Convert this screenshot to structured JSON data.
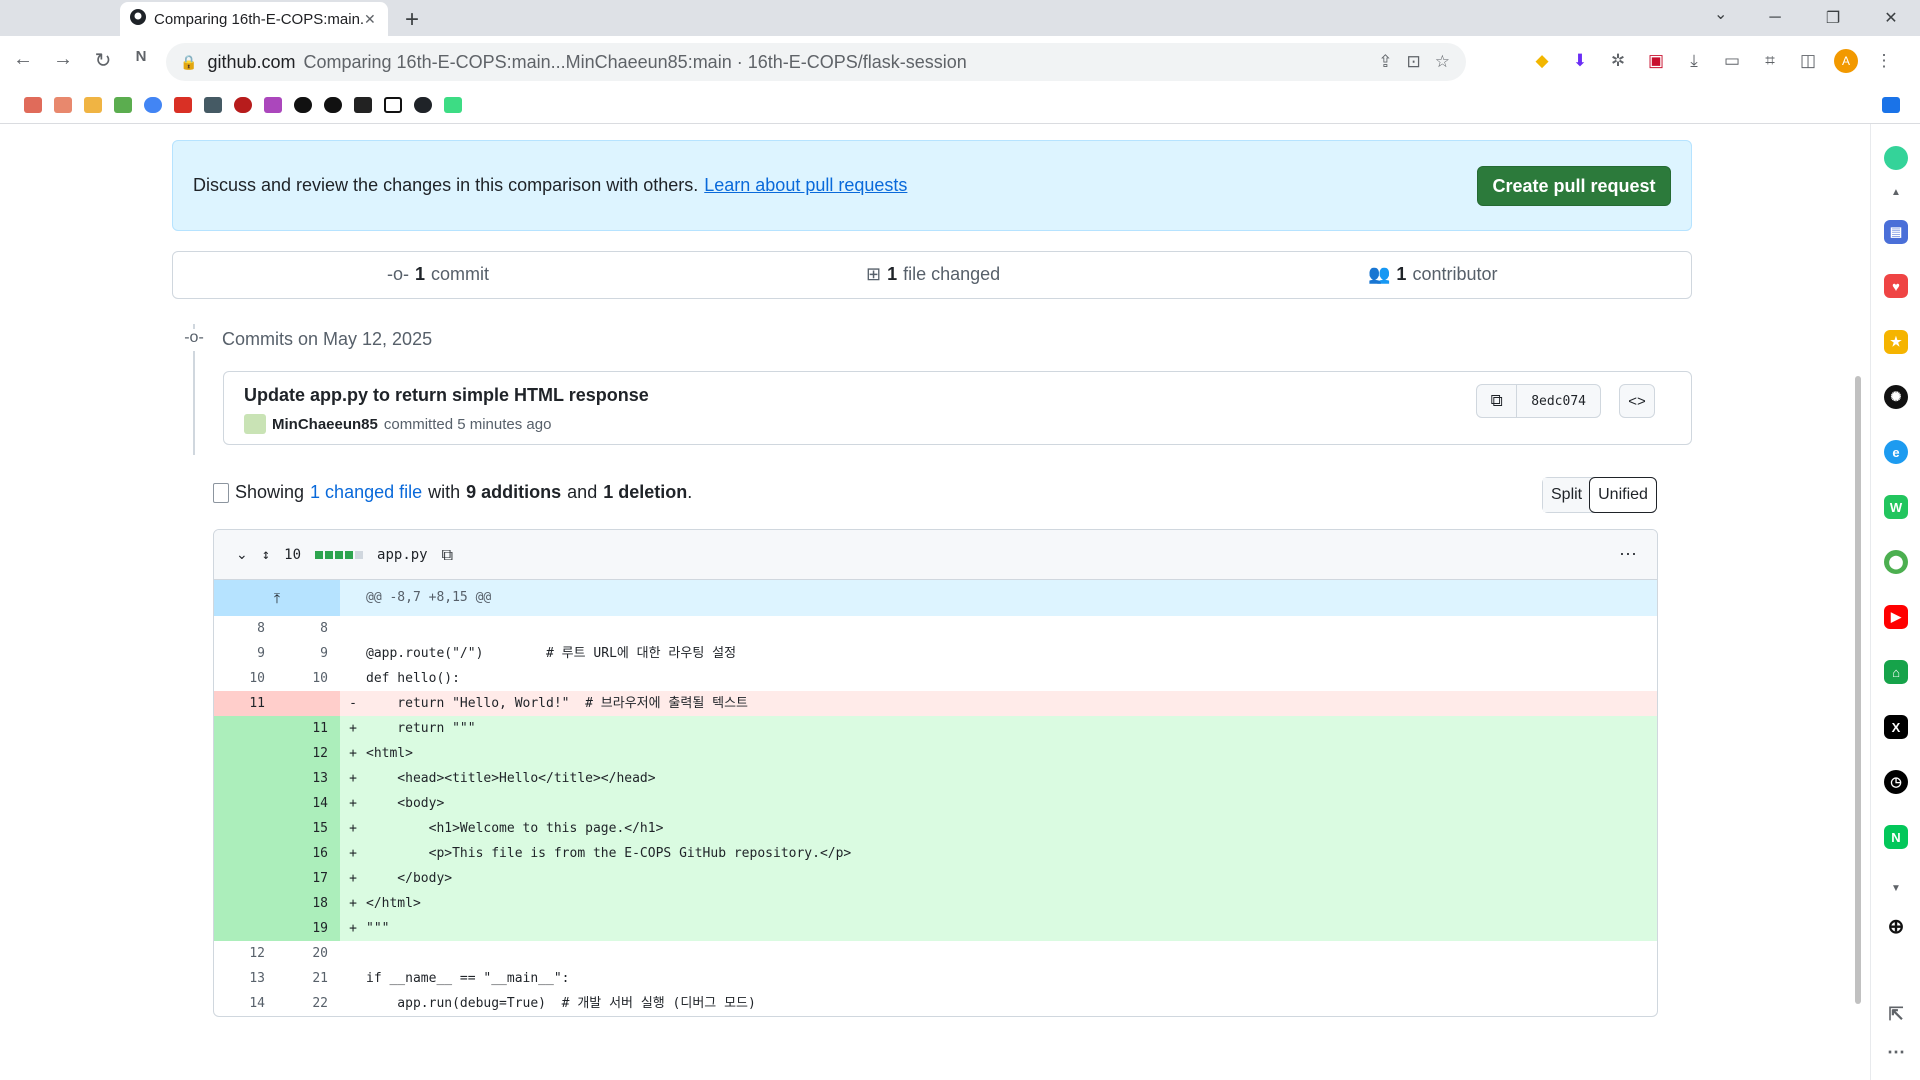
{
  "browser": {
    "tab_title": "Comparing 16th-E-COPS:main...",
    "url_domain": "github.com",
    "url_rest": "Comparing 16th-E-COPS:main...MinChaeeun85:main · 16th-E-COPS/flask-session"
  },
  "banner": {
    "text": "Discuss and review the changes in this comparison with others.",
    "link": "Learn about pull requests",
    "button": "Create pull request"
  },
  "summary": {
    "commits_count": "1",
    "commits_label": "commit",
    "files_count": "1",
    "files_label": "file changed",
    "contributors_count": "1",
    "contributors_label": "contributor"
  },
  "commits": {
    "heading": "Commits on May 12, 2025",
    "message": "Update app.py to return simple HTML response",
    "author": "MinChaeeun85",
    "meta": "committed 5 minutes ago",
    "sha": "8edc074"
  },
  "showing": {
    "prefix": "Showing",
    "files_link": "1 changed file",
    "with": "with",
    "additions": "9 additions",
    "and": "and",
    "deletions": "1 deletion",
    "period": "."
  },
  "view_toggle": {
    "split": "Split",
    "unified": "Unified"
  },
  "diff": {
    "changes": "10",
    "filename": "app.py",
    "hunk_header": "@@ -8,7 +8,15 @@",
    "lines": [
      {
        "type": "ctx",
        "old": "8",
        "new": "8",
        "sign": "",
        "code": ""
      },
      {
        "type": "ctx",
        "old": "9",
        "new": "9",
        "sign": "",
        "code": "@app.route(\"/\")        # 루트 URL에 대한 라우팅 설정"
      },
      {
        "type": "ctx",
        "old": "10",
        "new": "10",
        "sign": "",
        "code": "def hello():"
      },
      {
        "type": "del",
        "old": "11",
        "new": "",
        "sign": "-",
        "code": "    return \"Hello, World!\"  # 브라우저에 출력될 텍스트"
      },
      {
        "type": "add",
        "old": "",
        "new": "11",
        "sign": "+",
        "code": "    return \"\"\""
      },
      {
        "type": "add",
        "old": "",
        "new": "12",
        "sign": "+",
        "code": "<html>"
      },
      {
        "type": "add",
        "old": "",
        "new": "13",
        "sign": "+",
        "code": "    <head><title>Hello</title></head>"
      },
      {
        "type": "add",
        "old": "",
        "new": "14",
        "sign": "+",
        "code": "    <body>"
      },
      {
        "type": "add",
        "old": "",
        "new": "15",
        "sign": "+",
        "code": "        <h1>Welcome to this page.</h1>"
      },
      {
        "type": "add",
        "old": "",
        "new": "16",
        "sign": "+",
        "code": "        <p>This file is from the E-COPS GitHub repository.</p>"
      },
      {
        "type": "add",
        "old": "",
        "new": "17",
        "sign": "+",
        "code": "    </body>"
      },
      {
        "type": "add",
        "old": "",
        "new": "18",
        "sign": "+",
        "code": "</html>"
      },
      {
        "type": "add",
        "old": "",
        "new": "19",
        "sign": "+",
        "code": "\"\"\""
      },
      {
        "type": "ctx",
        "old": "12",
        "new": "20",
        "sign": "",
        "code": ""
      },
      {
        "type": "ctx",
        "old": "13",
        "new": "21",
        "sign": "",
        "code": "if __name__ == \"__main__\":"
      },
      {
        "type": "ctx",
        "old": "14",
        "new": "22",
        "sign": "",
        "code": "    app.run(debug=True)  # 개발 서버 실행 (디버그 모드)"
      }
    ]
  },
  "colors": {
    "primary_button": "#2c7a3b",
    "link": "#0969da",
    "addition_bg": "#dafbe1",
    "deletion_bg": "#ffebe9"
  }
}
